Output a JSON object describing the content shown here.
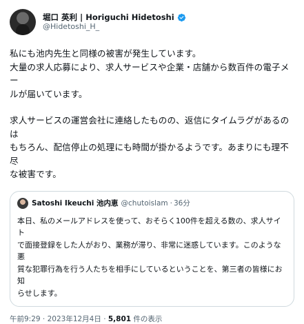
{
  "author": {
    "display_name": "堀口 英利 | Horiguchi Hidetoshi",
    "handle": "@Hidetoshi_H_",
    "verified_color": "#1d9bf0"
  },
  "tweet": {
    "lines": [
      "私にも池内先生と同様の被害が発生しています。",
      "大量の求人応募により、求人サービスや企業・店舗から数百件の電子メー",
      "ルが届いています。",
      "",
      "求人サービスの運営会社に連絡したものの、返信にタイムラグがあるのは",
      "もちろん、配信停止の処理にも時間が掛かるようです。あまりにも理不尽",
      "な被害です。"
    ]
  },
  "quote": {
    "display_name": "Satoshi Ikeuchi 池内恵",
    "handle": "@chutoislam",
    "separator": "·",
    "time": "36分",
    "lines": [
      "本日、私のメールアドレスを使って、おそらく100件を超える数の、求人サイト",
      "で面接登録をした人がおり、業務が滞り、非常に迷惑しています。このような悪",
      "質な犯罪行為を行う人たちを相手にしているということを、第三者の皆様にお知",
      "らせします。"
    ]
  },
  "meta": {
    "timestamp": "午前9:29 · 2023年12月4日 · ",
    "views_count": "5,801",
    "views_label": " 件の表示"
  }
}
